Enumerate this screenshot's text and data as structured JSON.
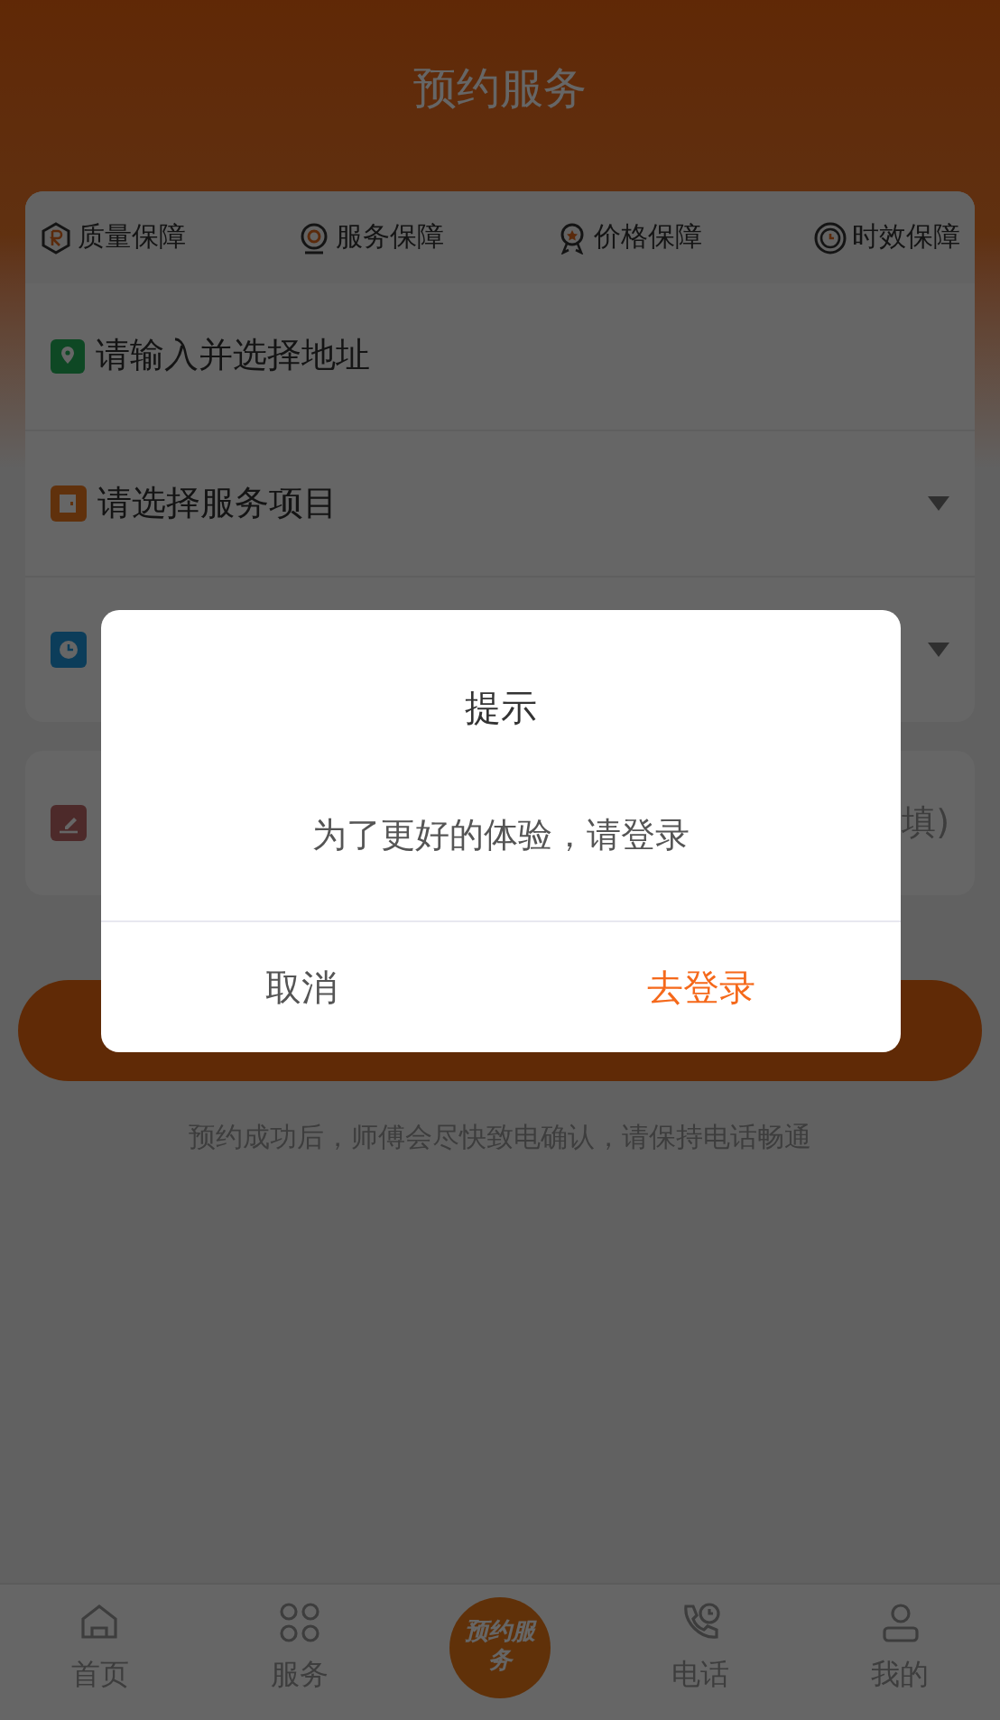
{
  "header": {
    "title": "预约服务"
  },
  "guarantees": [
    {
      "label": "质量保障",
      "kind": "quality"
    },
    {
      "label": "服务保障",
      "kind": "service"
    },
    {
      "label": "价格保障",
      "kind": "price"
    },
    {
      "label": "时效保障",
      "kind": "time"
    }
  ],
  "form_rows": [
    {
      "kind": "address",
      "placeholder": "请输入并选择地址",
      "dropdown": false
    },
    {
      "kind": "service",
      "placeholder": "请选择服务项目",
      "dropdown": true
    },
    {
      "kind": "time",
      "dropdown": true
    }
  ],
  "note_row": {
    "kind": "note",
    "visible_text": "填)"
  },
  "note_text": "预约成功后，师傅会尽快致电确认，请保持电话畅通",
  "tab_bar": [
    {
      "label": "首页",
      "kind": "home"
    },
    {
      "label": "服务",
      "kind": "apps"
    },
    {
      "label": "预约服务",
      "kind": "center"
    },
    {
      "label": "电话",
      "kind": "phone"
    },
    {
      "label": "我的",
      "kind": "user"
    }
  ],
  "dialog": {
    "title": "提示",
    "message": "为了更好的体验，请登录",
    "cancel": "取消",
    "confirm": "去登录"
  }
}
